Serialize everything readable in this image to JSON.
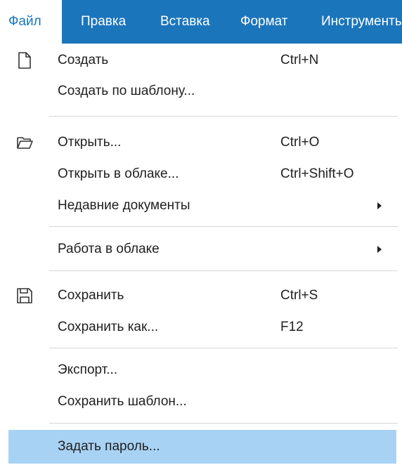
{
  "menubar": {
    "items": [
      {
        "label": "Файл"
      },
      {
        "label": "Правка"
      },
      {
        "label": "Вставка"
      },
      {
        "label": "Формат"
      },
      {
        "label": "Инструменты"
      }
    ]
  },
  "file_menu": {
    "items": [
      {
        "label": "Создать",
        "shortcut": "Ctrl+N",
        "icon": "new-document-icon"
      },
      {
        "label": "Создать по шаблону..."
      },
      {
        "label": "Открыть...",
        "shortcut": "Ctrl+O",
        "icon": "open-folder-icon"
      },
      {
        "label": "Открыть в облаке...",
        "shortcut": "Ctrl+Shift+O"
      },
      {
        "label": "Недавние документы",
        "submenu": true
      },
      {
        "label": "Работа в облаке",
        "submenu": true
      },
      {
        "label": "Сохранить",
        "shortcut": "Ctrl+S",
        "icon": "save-icon"
      },
      {
        "label": "Сохранить как...",
        "shortcut": "F12"
      },
      {
        "label": "Экспорт..."
      },
      {
        "label": "Сохранить шаблон..."
      },
      {
        "label": "Задать пароль...",
        "highlighted": true
      }
    ]
  },
  "colors": {
    "menubar_bg": "#1b75bb",
    "menubar_text": "#ffffff",
    "highlight": "#a8d2f4",
    "separator": "#d6d6d6"
  }
}
